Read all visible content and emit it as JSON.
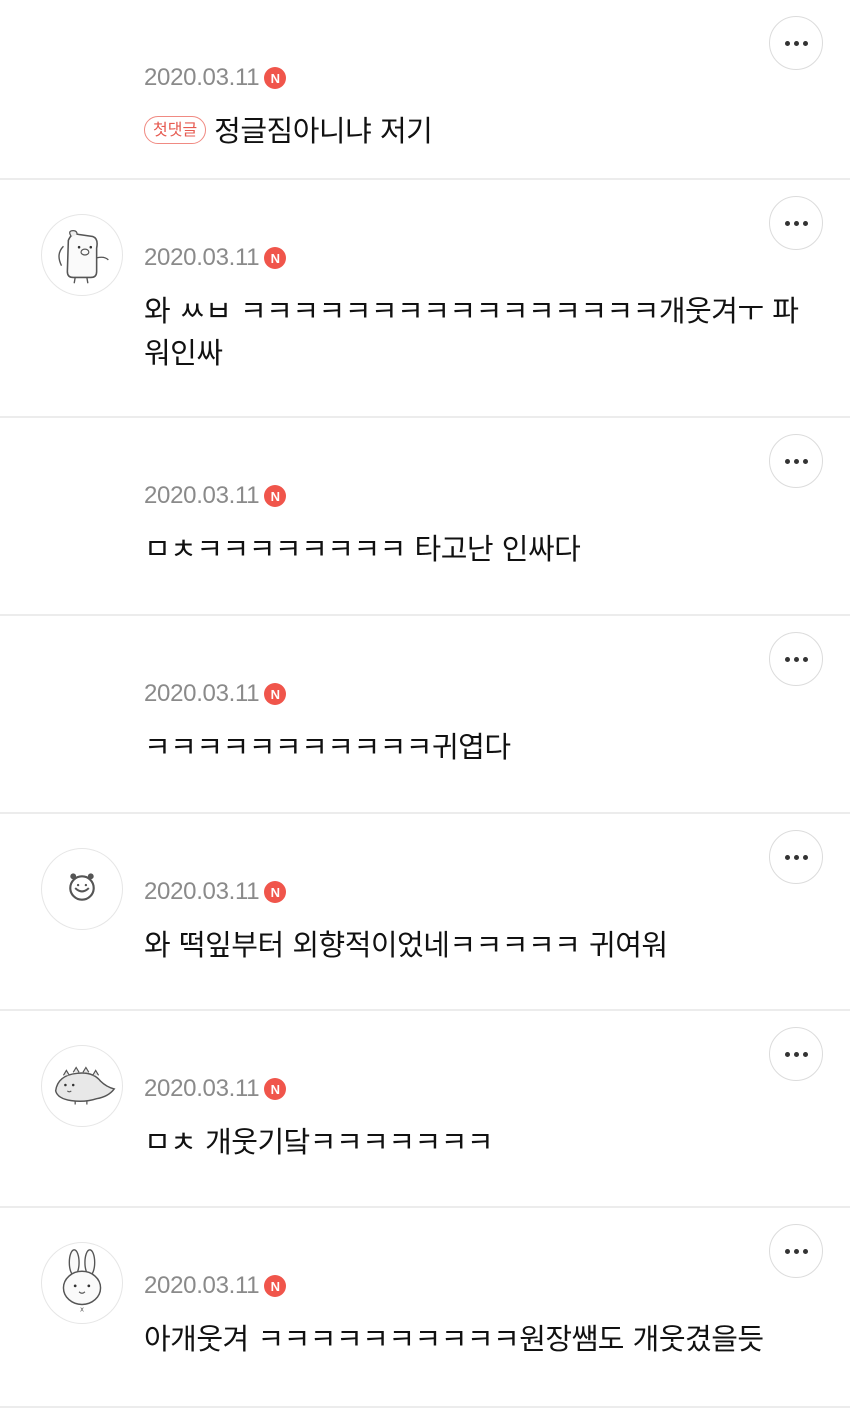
{
  "more_icon": "more-dots-icon",
  "new_badge_icon": "new-n-badge",
  "colors": {
    "new_badge": "#f0554b",
    "first_badge_border": "#f08a82",
    "first_badge_text": "#e65a50",
    "date": "#8a8a8a",
    "divider": "#ececec"
  },
  "comments": [
    {
      "date": "2020.03.11",
      "badge": "N",
      "first_label": "첫댓글",
      "text": "정글짐아니냐 저기",
      "avatar": "none"
    },
    {
      "date": "2020.03.11",
      "badge": "N",
      "text": "와 ㅆㅂ ㅋㅋㅋㅋㅋㅋㅋㅋㅋㅋㅋㅋㅋㅋㅋㅋ개웃겨ㅜ 파워인싸",
      "avatar": "pig-character-icon"
    },
    {
      "date": "2020.03.11",
      "badge": "N",
      "text": "ㅁㅊㅋㅋㅋㅋㅋㅋㅋㅋ 타고난 인싸다",
      "avatar": "none"
    },
    {
      "date": "2020.03.11",
      "badge": "N",
      "text": "ㅋㅋㅋㅋㅋㅋㅋㅋㅋㅋㅋ귀엽다",
      "avatar": "none"
    },
    {
      "date": "2020.03.11",
      "badge": "N",
      "text": "와 떡잎부터 외향적이었네ㅋㅋㅋㅋㅋ 귀여워",
      "avatar": "bear-face-icon"
    },
    {
      "date": "2020.03.11",
      "badge": "N",
      "text": "ㅁㅊ 개웃기닼ㅋㅋㅋㅋㅋㅋㅋ",
      "avatar": "dinosaur-character-icon"
    },
    {
      "date": "2020.03.11",
      "badge": "N",
      "text": "아개웃겨 ㅋㅋㅋㅋㅋㅋㅋㅋㅋㅋ원장쌤도 개웃겼을듯",
      "avatar": "rabbit-character-icon"
    }
  ]
}
